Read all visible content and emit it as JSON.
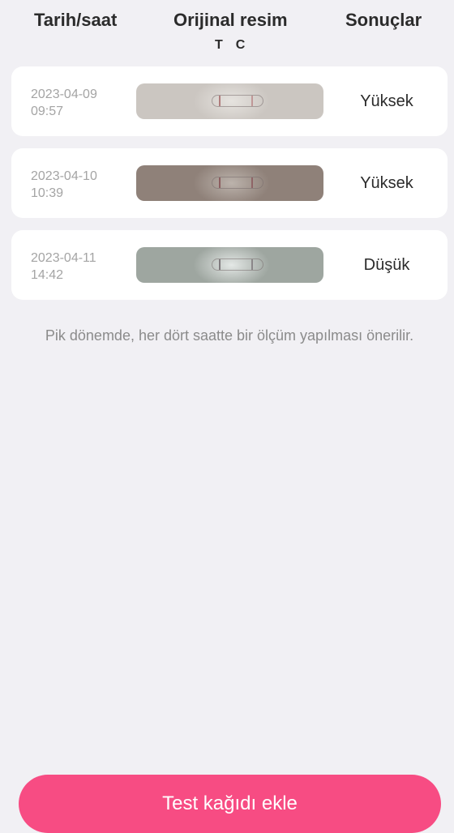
{
  "header": {
    "date_label": "Tarih/saat",
    "image_label": "Orijinal resim",
    "t_label": "T",
    "c_label": "C",
    "result_label": "Sonuçlar"
  },
  "records": [
    {
      "date": "2023-04-09",
      "time": "09:57",
      "result": "Yüksek"
    },
    {
      "date": "2023-04-10",
      "time": "10:39",
      "result": "Yüksek"
    },
    {
      "date": "2023-04-11",
      "time": "14:42",
      "result": "Düşük"
    }
  ],
  "hint": "Pik dönemde, her dört saatte bir ölçüm yapılması önerilir.",
  "add_button_label": "Test kağıdı ekle",
  "colors": {
    "background": "#f1f0f4",
    "card": "#ffffff",
    "accent": "#f74c83",
    "date_text": "#a4a4a4",
    "hint_text": "#8b8b8b"
  }
}
